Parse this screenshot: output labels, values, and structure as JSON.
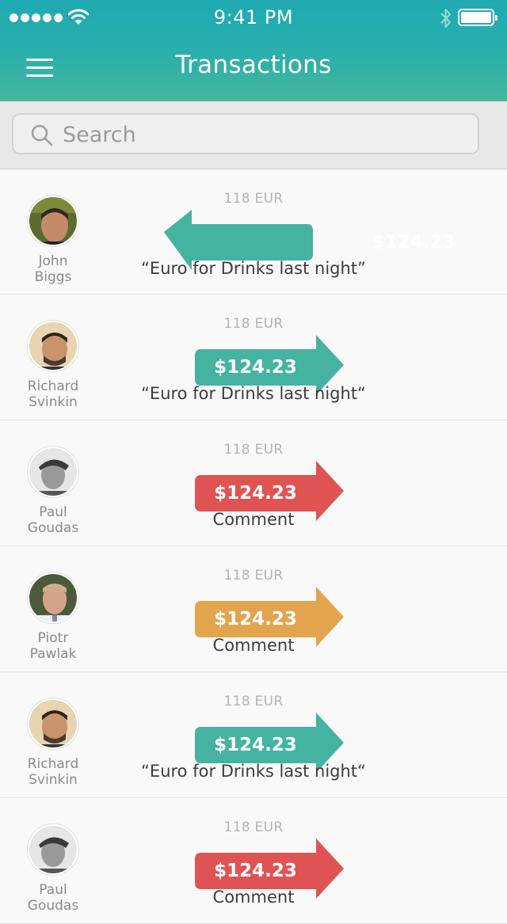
{
  "status_bar": {
    "time": "9:41 PM"
  },
  "header": {
    "title": "Transactions"
  },
  "search": {
    "placeholder": "Search"
  },
  "colors": {
    "teal": "#44b3a1",
    "red": "#e05353",
    "orange": "#e2a54d"
  },
  "transactions": [
    {
      "name_first": "John",
      "name_last": "Biggs",
      "eur": "118 EUR",
      "amount": "$124.23",
      "direction": "incoming",
      "color": "teal",
      "comment": "“Euro for Drinks last night”"
    },
    {
      "name_first": "Richard",
      "name_last": "Svinkin",
      "eur": "118 EUR",
      "amount": "$124.23",
      "direction": "outgoing",
      "color": "teal",
      "comment": "“Euro for Drinks last night“"
    },
    {
      "name_first": "Paul",
      "name_last": "Goudas",
      "eur": "118 EUR",
      "amount": "$124.23",
      "direction": "outgoing",
      "color": "red",
      "comment": "Comment"
    },
    {
      "name_first": "Piotr",
      "name_last": "Pawlak",
      "eur": "118 EUR",
      "amount": "$124.23",
      "direction": "outgoing",
      "color": "orange",
      "comment": "Comment"
    },
    {
      "name_first": "Richard",
      "name_last": "Svinkin",
      "eur": "118 EUR",
      "amount": "$124.23",
      "direction": "outgoing",
      "color": "teal",
      "comment": "“Euro for Drinks last night“"
    },
    {
      "name_first": "Paul",
      "name_last": "Goudas",
      "eur": "118 EUR",
      "amount": "$124.23",
      "direction": "outgoing",
      "color": "red",
      "comment": "Comment"
    }
  ]
}
